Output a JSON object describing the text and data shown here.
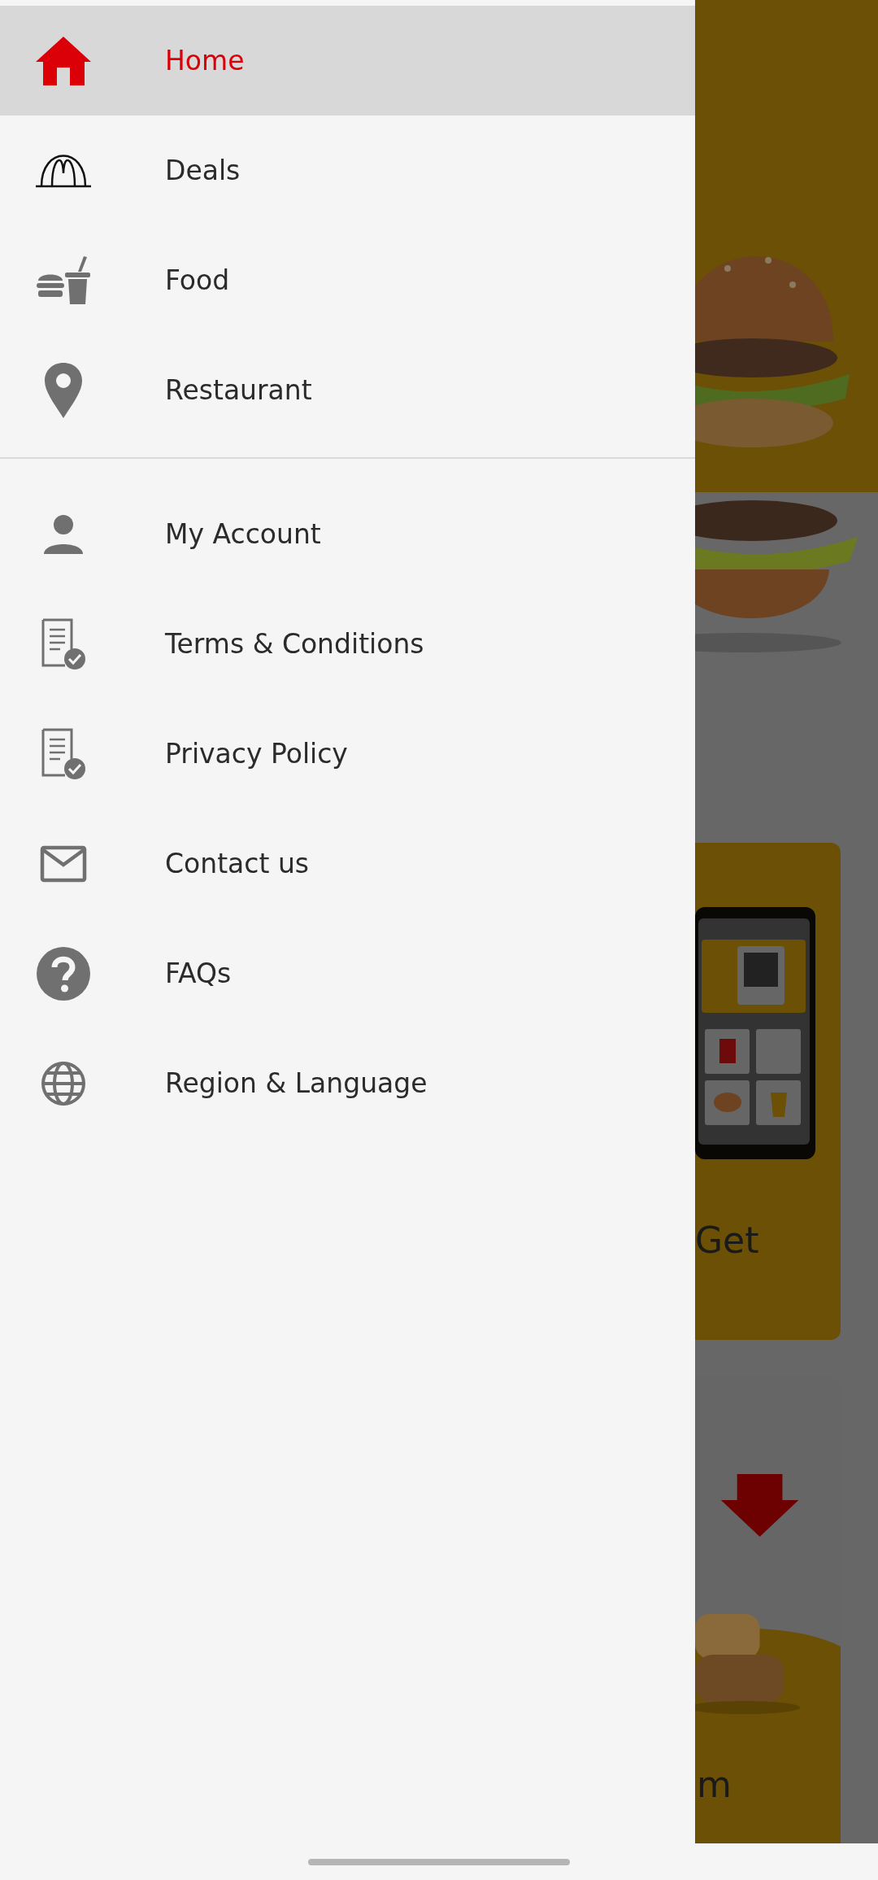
{
  "menu": {
    "primary": [
      {
        "label": "Home",
        "selected": true
      },
      {
        "label": "Deals",
        "selected": false
      },
      {
        "label": "Food",
        "selected": false
      },
      {
        "label": "Restaurant",
        "selected": false
      }
    ],
    "secondary": [
      {
        "label": "My Account",
        "selected": false
      },
      {
        "label": "Terms & Conditions",
        "selected": false
      },
      {
        "label": "Privacy Policy",
        "selected": false
      },
      {
        "label": "Contact us",
        "selected": false
      },
      {
        "label": "FAQs",
        "selected": false
      },
      {
        "label": "Region & Language",
        "selected": false
      }
    ]
  },
  "background": {
    "order_card": {
      "caption": "Get"
    },
    "offer_card": {
      "caption": "m"
    }
  }
}
